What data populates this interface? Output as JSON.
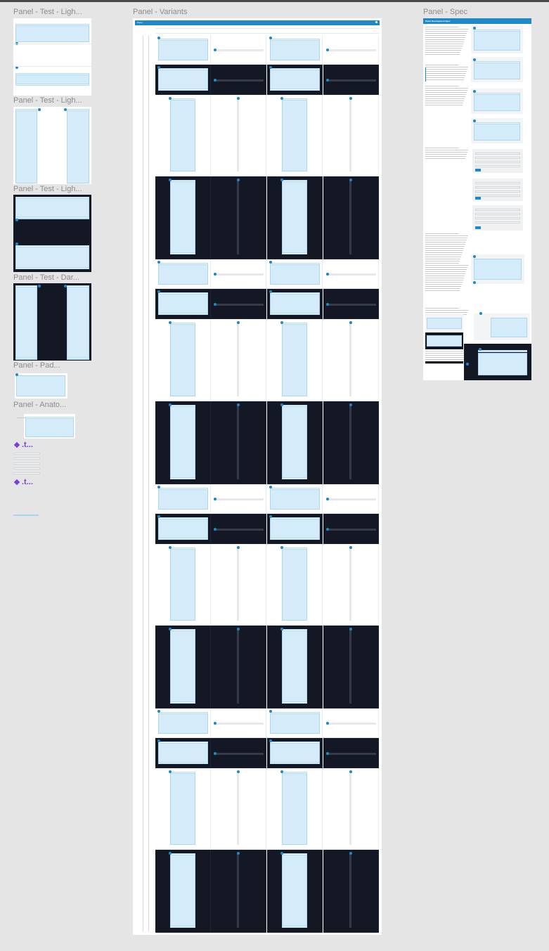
{
  "frames": {
    "test_light_1": "Panel - Test - Ligh...",
    "test_light_2": "Panel - Test - Ligh...",
    "test_light_3": "Panel - Test - Ligh...",
    "test_dark": "Panel - Test - Dar...",
    "padding": "Panel - Pad...",
    "anatomy": "Panel - Anato...",
    "variants": "Panel - Variants",
    "spec": "Panel - Spec"
  },
  "components": {
    "link_1": ".t...",
    "link_2": ".t..."
  },
  "variants_board": {
    "header_title": "Panel"
  },
  "spec_board": {
    "header_title": "Panel Development Spec"
  },
  "colors": {
    "canvas": "#e5e5e5",
    "accent": "#1e88c8",
    "panel_fill": "#d4ecf9",
    "dark_bg": "#141824",
    "component": "#7b3fd6"
  }
}
